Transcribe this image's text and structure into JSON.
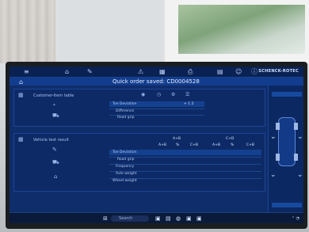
{
  "banner": {
    "title": "Quick order saved: CD0004528"
  },
  "panels": {
    "panel1": {
      "title": "Customer-item table",
      "header_icons": [
        "circle-icon",
        "clock-icon",
        "gear-icon",
        "list-icon"
      ],
      "rows": [
        {
          "label": "Toe Deviation",
          "values": [
            "",
            "",
            "+ 1 2"
          ]
        },
        {
          "label": "Difference",
          "values": [
            "",
            "",
            ""
          ]
        },
        {
          "label": "Road grip",
          "values": [
            "",
            "",
            ""
          ]
        }
      ]
    },
    "panel2": {
      "title": "Vehicle test result",
      "col_groups": [
        "A+B",
        "C+D"
      ],
      "cols": [
        "A+B",
        "%",
        "C+B",
        "A+B",
        "%",
        "C+B"
      ],
      "rows": [
        {
          "label": "Toe Deviation",
          "values": [
            "",
            "",
            "",
            "",
            "",
            ""
          ]
        },
        {
          "label": "Road grip",
          "values": [
            "",
            "",
            "",
            "",
            "",
            ""
          ]
        },
        {
          "label": "Frequency",
          "values": [
            "",
            "",
            "",
            "",
            "",
            ""
          ]
        },
        {
          "label": "Axle weight",
          "values": [
            "",
            "",
            "",
            "",
            "",
            ""
          ]
        },
        {
          "label": "Wheel weight",
          "values": [
            "",
            "",
            "",
            "",
            "",
            ""
          ]
        }
      ]
    }
  },
  "brand": "SCHENCK-ROTEC",
  "taskbar": {
    "search_placeholder": "Search"
  },
  "colors": {
    "screen_bg": "#0f2d6a",
    "accent": "#123d8f"
  }
}
